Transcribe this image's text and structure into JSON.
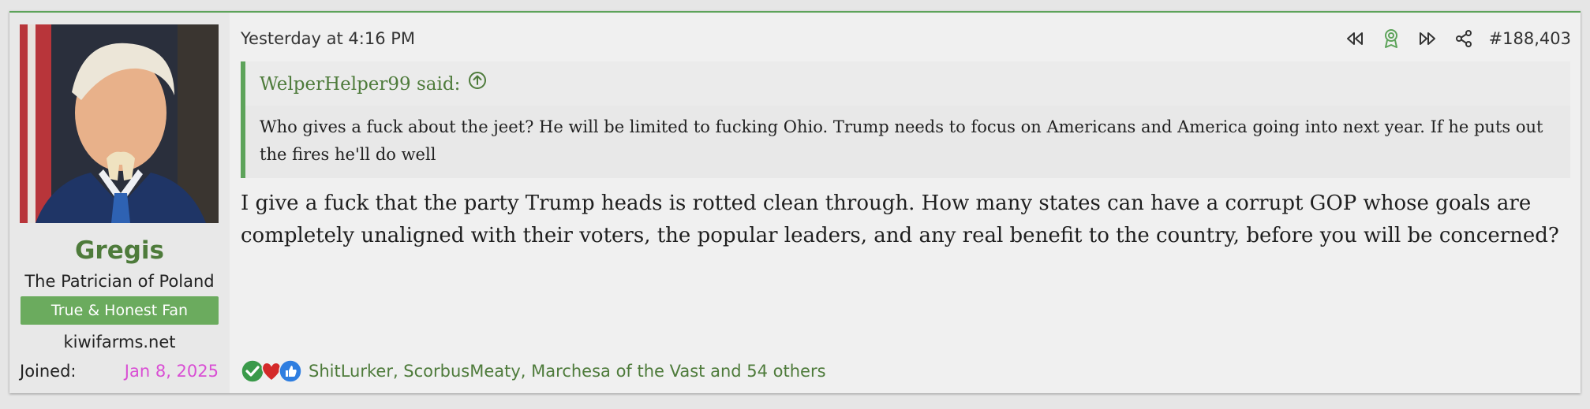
{
  "user": {
    "name": "Gregis",
    "title": "The Patrician of Poland",
    "banner": "True & Honest Fan",
    "site": "kiwifarms.net",
    "joined_label": "Joined:",
    "joined_value": "Jan 8, 2025"
  },
  "post": {
    "timestamp": "Yesterday at 4:16 PM",
    "number": "#188,403",
    "message": "I give a fuck that the party Trump heads is rotted clean through. How many states can have a corrupt GOP whose goals are completely unaligned with their voters, the popular leaders, and any real benefit to the country, before you will be concerned?"
  },
  "quote": {
    "author": "WelperHelper99 said:",
    "body": "Who gives a fuck about the jeet? He will be limited to fucking Ohio. Trump needs to focus on Americans and America going into next year. If he puts out the fires he'll do well"
  },
  "reactions": {
    "icons": [
      "check-reaction-icon",
      "heart-reaction-icon",
      "thumbs-up-reaction-icon"
    ],
    "text": "ShitLurker, ScorbusMeaty, Marchesa of the Vast and 54 others"
  },
  "colors": {
    "accent": "#5da35a",
    "username": "#4e7b3b",
    "joined": "#d94fd4",
    "banner": "#6bab5e"
  }
}
